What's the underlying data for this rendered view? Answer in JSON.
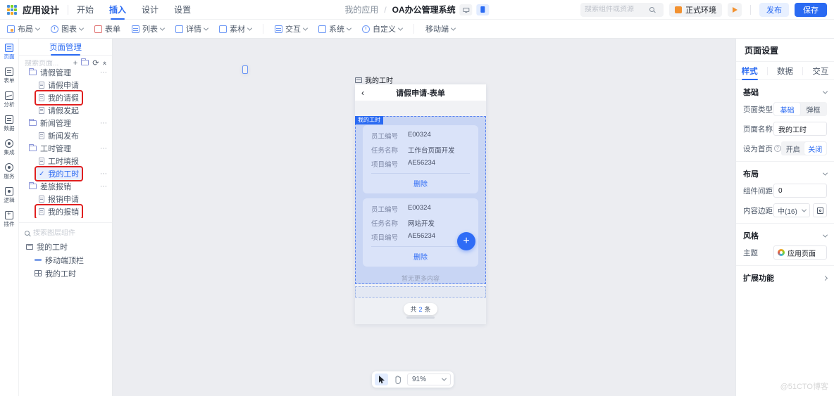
{
  "topbar": {
    "app_title": "应用设计",
    "menu": [
      {
        "label": "开始"
      },
      {
        "label": "插入"
      },
      {
        "label": "设计"
      },
      {
        "label": "设置"
      }
    ],
    "breadcrumb": {
      "parent": "我的应用",
      "separator": "/",
      "current": "OA办公管理系统"
    },
    "search_placeholder": "搜索组件或资源",
    "env_label": "正式环境",
    "publish_label": "发布",
    "save_label": "保存"
  },
  "insert_toolbar": [
    {
      "label": "布局"
    },
    {
      "label": "图表"
    },
    {
      "label": "表单"
    },
    {
      "label": "列表"
    },
    {
      "label": "详情"
    },
    {
      "label": "素材"
    },
    {
      "label": "交互"
    },
    {
      "label": "系统"
    },
    {
      "label": "自定义"
    },
    {
      "label": "移动端"
    }
  ],
  "left_rail": [
    {
      "label": "页面"
    },
    {
      "label": "表单"
    },
    {
      "label": "分析"
    },
    {
      "label": "数据"
    },
    {
      "label": "集成"
    },
    {
      "label": "服务"
    },
    {
      "label": "逻辑"
    },
    {
      "label": "插件"
    }
  ],
  "pages_panel": {
    "title": "页面管理",
    "search_placeholder": "搜索页面...",
    "tree": [
      {
        "label": "请假管理"
      },
      {
        "label": "请假申请"
      },
      {
        "label": "我的请假"
      },
      {
        "label": "请假发起"
      },
      {
        "label": "新闻管理"
      },
      {
        "label": "新闻发布"
      },
      {
        "label": "工时管理"
      },
      {
        "label": "工时填报"
      },
      {
        "label": "我的工时"
      },
      {
        "label": "差旅报销"
      },
      {
        "label": "报销申请"
      },
      {
        "label": "我的报销"
      }
    ],
    "layers_search_placeholder": "搜索图层组件",
    "layers": [
      {
        "label": "我的工时"
      },
      {
        "label": "移动端顶栏"
      },
      {
        "label": "我的工时"
      }
    ]
  },
  "canvas": {
    "page_tag": "我的工时",
    "mobile": {
      "header_title": "请假申请-表单",
      "selection_tag": "我的工时",
      "cards": [
        {
          "rows": [
            {
              "label": "员工编号",
              "value": "E00324"
            },
            {
              "label": "任务名称",
              "value": "工作台页面开发"
            },
            {
              "label": "项目编号",
              "value": "AE56234"
            }
          ],
          "action": "删除"
        },
        {
          "rows": [
            {
              "label": "员工编号",
              "value": "E00324"
            },
            {
              "label": "任务名称",
              "value": "网站开发"
            },
            {
              "label": "项目编号",
              "value": "AE56234"
            }
          ],
          "action": "删除"
        }
      ],
      "empty_text": "暂无更多内容",
      "fab_label": "+",
      "count_prefix": "共",
      "count_value": "2",
      "count_suffix": "条"
    },
    "zoom_level": "91%",
    "watermark": "@51CTO博客"
  },
  "settings_panel": {
    "title": "页面设置",
    "tabs": [
      {
        "label": "样式"
      },
      {
        "label": "数据"
      },
      {
        "label": "交互"
      }
    ],
    "basic": {
      "title": "基础",
      "page_type_label": "页面类型",
      "page_type_options": [
        {
          "label": "基础"
        },
        {
          "label": "弹框"
        }
      ],
      "page_name_label": "页面名称",
      "page_name_value": "我的工时",
      "homepage_label": "设为首页",
      "homepage_options": [
        {
          "label": "开启"
        },
        {
          "label": "关闭"
        }
      ]
    },
    "layout": {
      "title": "布局",
      "spacing_label": "组件间距",
      "spacing_value": "0",
      "padding_label": "内容边距",
      "padding_value": "中(16)"
    },
    "style": {
      "title": "风格",
      "theme_label": "主题",
      "theme_value": "应用页面"
    },
    "extended_title": "扩展功能"
  }
}
